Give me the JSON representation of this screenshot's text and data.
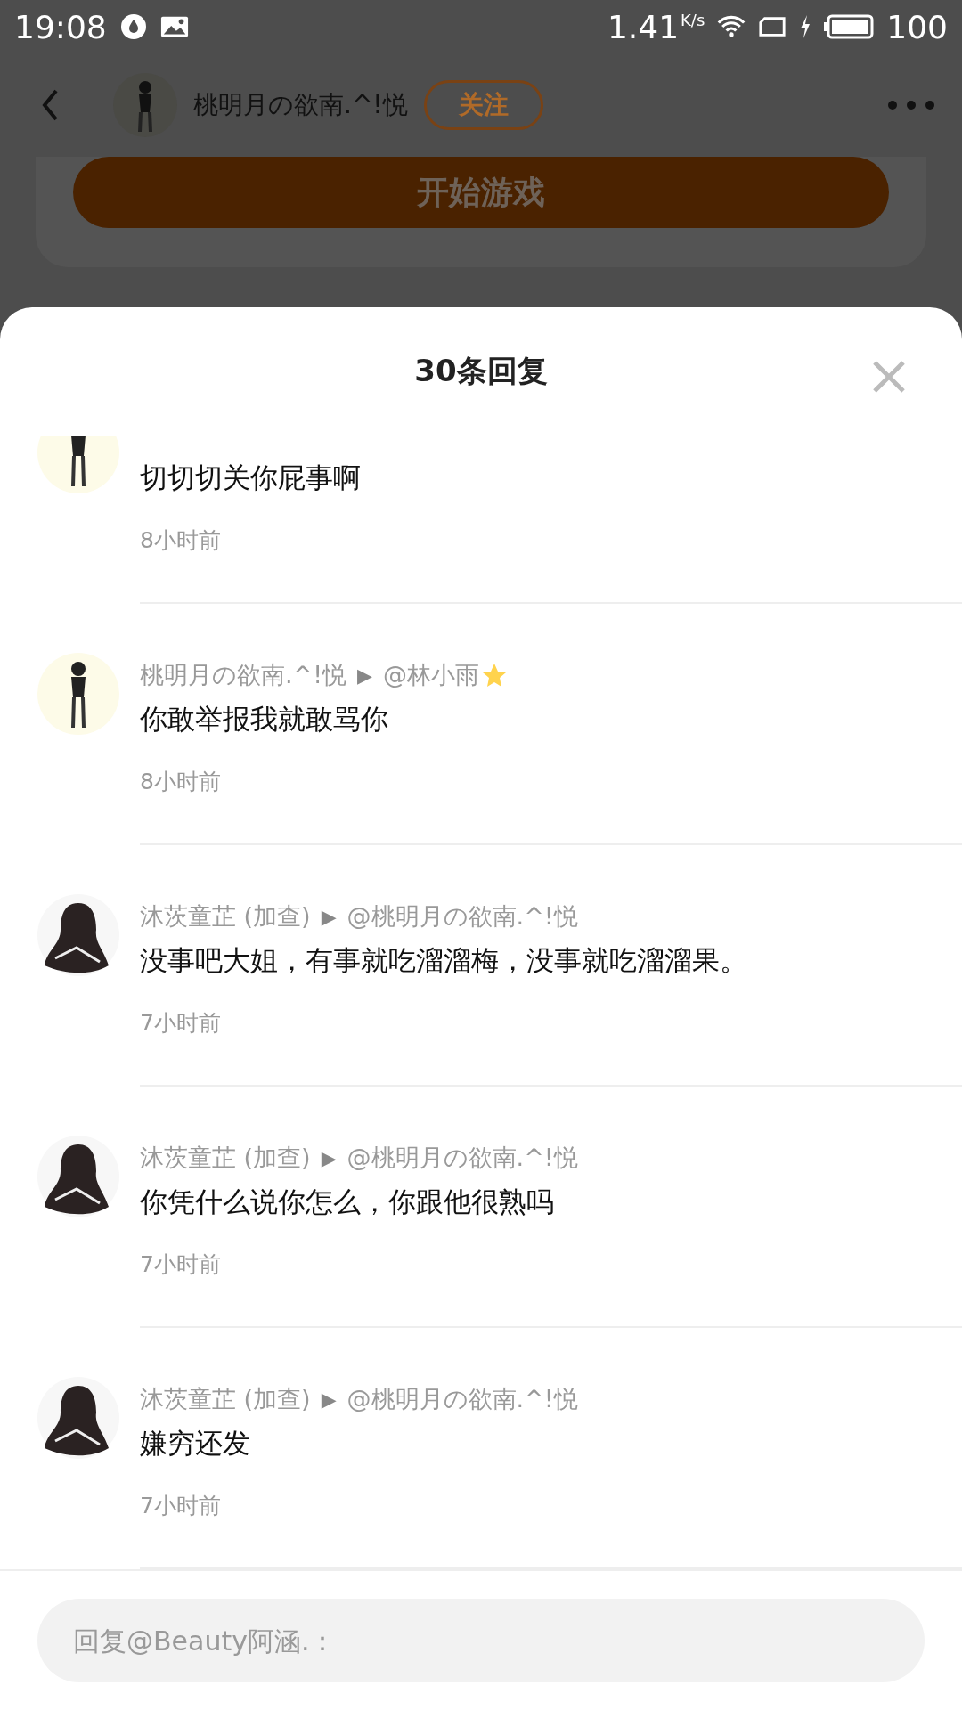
{
  "status_bar": {
    "time": "19:08",
    "speed": "1.41",
    "speed_unit": "K/s",
    "battery": "100"
  },
  "header": {
    "author": "桃明月の欲南.^!悦",
    "follow_label": "关注"
  },
  "background": {
    "start_button": "开始游戏"
  },
  "sheet": {
    "title": "30条回复"
  },
  "comments": [
    {
      "kind": "figure",
      "content": "切切切关你屁事啊",
      "time": "8小时前"
    },
    {
      "kind": "figure",
      "author": "桃明月の欲南.^!悦",
      "arrow": "▶",
      "reply_to": "@林小雨",
      "star": true,
      "content": "你敢举报我就敢骂你",
      "time": "8小时前"
    },
    {
      "kind": "hooded",
      "author": "沐茨童芷 (加查)",
      "arrow": "▶",
      "reply_to": "@桃明月の欲南.^!悦",
      "content": "没事吧大姐，有事就吃溜溜梅，没事就吃溜溜果。",
      "time": "7小时前"
    },
    {
      "kind": "hooded",
      "author": "沐茨童芷 (加查)",
      "arrow": "▶",
      "reply_to": "@桃明月の欲南.^!悦",
      "content": "你凭什么说你怎么，你跟他很熟吗",
      "time": "7小时前"
    },
    {
      "kind": "hooded",
      "author": "沐茨童芷 (加查)",
      "arrow": "▶",
      "reply_to": "@桃明月の欲南.^!悦",
      "content": "嫌穷还发",
      "time": "7小时前"
    }
  ],
  "reply_field": {
    "placeholder": "回复@Beauty阿涵.："
  }
}
